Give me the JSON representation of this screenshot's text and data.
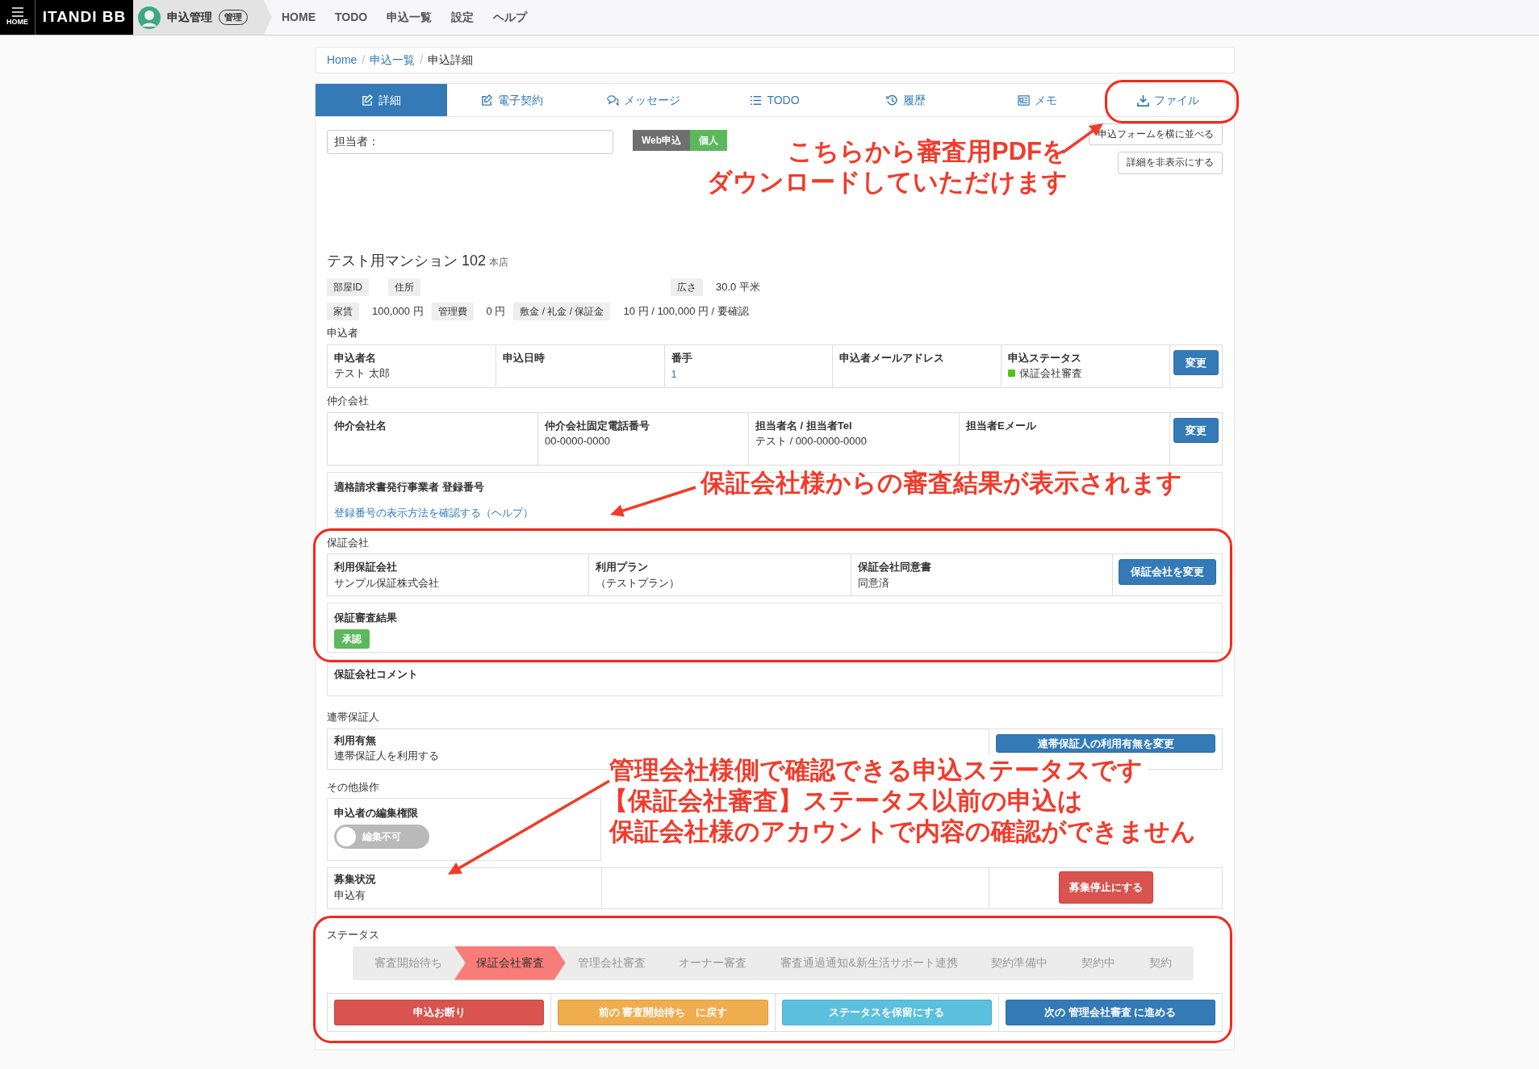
{
  "navbar": {
    "menu_label": "HOME",
    "brand": "ITANDI BB",
    "app_name": "申込管理",
    "app_badge": "管理",
    "links": [
      "HOME",
      "TODO",
      "申込一覧",
      "設定",
      "ヘルプ"
    ]
  },
  "breadcrumb": [
    {
      "label": "Home",
      "link": true,
      "separator": "/"
    },
    {
      "label": "申込一覧",
      "link": true,
      "separator": "/"
    },
    {
      "label": "申込詳細",
      "link": false
    }
  ],
  "tabs": [
    {
      "label": "詳細",
      "selected": true
    },
    {
      "label": "電子契約",
      "selected": false
    },
    {
      "label": "メッセージ",
      "selected": false
    },
    {
      "label": "TODO",
      "selected": false
    },
    {
      "label": "履歴",
      "selected": false
    },
    {
      "label": "メモ",
      "selected": false
    },
    {
      "label": "ファイル",
      "selected": false
    }
  ],
  "assignee_field": {
    "value": "担当者："
  },
  "tags": [
    {
      "label": "Web申込",
      "color": "#6f6f6f"
    },
    {
      "label": "個人",
      "color": "#5cb85c"
    }
  ],
  "side_buttons": [
    "申込フォームを横に並べる",
    "詳細を非表示にする"
  ],
  "property": {
    "name": "テスト用マンション 102",
    "branch": "本店",
    "lines": [
      {
        "items": [
          {
            "label": "部屋ID"
          },
          {
            "label": "住所"
          },
          {
            "label": "広さ",
            "value": "30.0 平米"
          }
        ]
      },
      {
        "items": [
          {
            "label": "家賃",
            "value": "100,000 円"
          },
          {
            "label": "管理費",
            "value": "0 円"
          },
          {
            "label": "敷金 / 礼金 / 保証金",
            "value": "10 円 / 100,000 円 / 要確認"
          }
        ]
      }
    ]
  },
  "applicant": {
    "title": "申込者",
    "cells": [
      {
        "label": "申込者名",
        "value": "テスト 太郎",
        "kind": "text"
      },
      {
        "label": "申込日時",
        "kind": "text"
      },
      {
        "label": "番手",
        "value": "1",
        "kind": "link"
      },
      {
        "label": "申込者メールアドレス",
        "kind": "text"
      },
      {
        "label": "申込ステータス",
        "value": "保証会社審査",
        "kind": "status",
        "color": "#52c41a"
      }
    ],
    "button": "変更"
  },
  "broker": {
    "title": "仲介会社",
    "cells": [
      {
        "label": "仲介会社名",
        "kind": "text"
      },
      {
        "label": "仲介会社固定電話番号",
        "value": "00-0000-0000",
        "kind": "text"
      },
      {
        "label": "担当者名 / 担当者Tel",
        "value": "テスト / 000-0000-0000",
        "kind": "text"
      },
      {
        "label": "担当者Eメール",
        "kind": "text"
      }
    ],
    "button": "変更"
  },
  "invoice": {
    "label": "適格請求書発行事業者 登録番号",
    "help_link": "登録番号の表示方法を確認する（ヘルプ）"
  },
  "guarantor": {
    "title": "保証会社",
    "cells": [
      {
        "label": "利用保証会社",
        "value": "サンプル保証株式会社",
        "kind": "text"
      },
      {
        "label": "利用プラン",
        "value": "（テストプラン）",
        "kind": "text"
      },
      {
        "label": "保証会社同意書",
        "value": "同意済",
        "kind": "text"
      }
    ],
    "button": "保証会社を変更",
    "result_label": "保証審査結果",
    "result_badge": "承認",
    "comment_label": "保証会社コメント"
  },
  "joint_guarantor": {
    "title": "連帯保証人",
    "label": "利用有無",
    "value": "連帯保証人を利用する",
    "button": "連帯保証人の利用有無を変更"
  },
  "other": {
    "title": "その他操作",
    "edit_permission": {
      "label": "申込者の編集権限",
      "toggle_label": "編集不可",
      "on": false
    },
    "recruitment": {
      "label": "募集状況",
      "value": "申込有",
      "button": "募集停止にする"
    }
  },
  "status": {
    "title": "ステータス",
    "steps": [
      {
        "label": "審査開始待ち",
        "selected": false
      },
      {
        "label": "保証会社審査",
        "selected": true
      },
      {
        "label": "管理会社審査",
        "selected": false
      },
      {
        "label": "オーナー審査",
        "selected": false
      },
      {
        "label": "審査通過通知&新生活サポート連携",
        "selected": false
      },
      {
        "label": "契約準備中",
        "selected": false
      },
      {
        "label": "契約中",
        "selected": false
      },
      {
        "label": "契約",
        "selected": false
      }
    ],
    "actions": [
      {
        "label": "申込お断り",
        "kind": "danger"
      },
      {
        "label": "前の 審査開始待ち　に戻す",
        "kind": "warning"
      },
      {
        "label": "ステータスを保留にする",
        "kind": "info"
      },
      {
        "label": "次の 管理会社審査 に進める",
        "kind": "primary"
      }
    ]
  },
  "annotations": [
    {
      "lines": [
        "こちらから審査用PDFを",
        "ダウンロードしていただけます"
      ]
    },
    {
      "lines": [
        "保証会社様からの審査結果が表示されます"
      ]
    },
    {
      "lines": [
        "管理会社様側で確認できる申込ステータスです",
        "【保証会社審査】ステータス以前の申込は",
        "保証会社様のアカウントで内容の確認ができません"
      ]
    }
  ]
}
